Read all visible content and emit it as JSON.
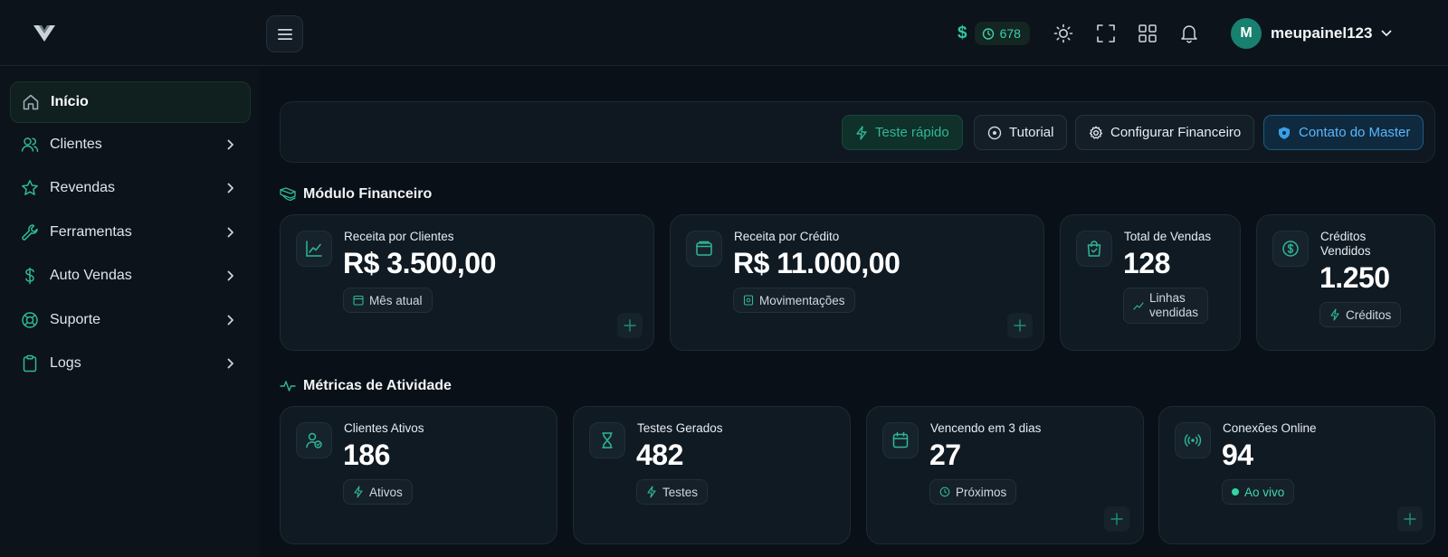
{
  "topbar": {
    "currency_symbol": "$",
    "balance": "678",
    "user_initial": "M",
    "username": "meupainel123"
  },
  "sidebar": {
    "items": [
      {
        "label": "Início",
        "icon": "home-icon",
        "active": true
      },
      {
        "label": "Clientes",
        "icon": "users-icon"
      },
      {
        "label": "Revendas",
        "icon": "star-icon"
      },
      {
        "label": "Ferramentas",
        "icon": "wrench-icon"
      },
      {
        "label": "Auto Vendas",
        "icon": "dollar-icon"
      },
      {
        "label": "Suporte",
        "icon": "lifebuoy-icon"
      },
      {
        "label": "Logs",
        "icon": "clipboard-icon"
      }
    ]
  },
  "actions": {
    "quick_test": "Teste rápido",
    "tutorial": "Tutorial",
    "config_finance": "Configurar Financeiro",
    "contact_master": "Contato do Master"
  },
  "finance": {
    "section_title": "Módulo Financeiro",
    "cards": [
      {
        "title": "Receita por Clientes",
        "value": "R$ 3.500,00",
        "chip": "Mês atual",
        "icon": "chart-line-icon"
      },
      {
        "title": "Receita por Crédito",
        "value": "R$ 11.000,00",
        "chip": "Movimentações",
        "icon": "wallet-icon"
      },
      {
        "title": "Total de Vendas",
        "value": "128",
        "chip_line1": "Linhas",
        "chip_line2": "vendidas",
        "icon": "shopping-bag-icon"
      },
      {
        "title_line1": "Créditos",
        "title_line2": "Vendidos",
        "value": "1.250",
        "chip": "Créditos",
        "icon": "coin-icon"
      }
    ]
  },
  "activity": {
    "section_title": "Métricas de Atividade",
    "cards": [
      {
        "title": "Clientes Ativos",
        "value": "186",
        "chip": "Ativos",
        "icon": "user-check-icon"
      },
      {
        "title": "Testes Gerados",
        "value": "482",
        "chip": "Testes",
        "icon": "hourglass-icon"
      },
      {
        "title": "Vencendo em 3 dias",
        "value": "27",
        "chip": "Próximos",
        "icon": "calendar-icon"
      },
      {
        "title": "Conexões Online",
        "value": "94",
        "chip": "Ao vivo",
        "icon": "broadcast-icon"
      }
    ]
  },
  "colors": {
    "accent": "#2fc7a4",
    "master_blue": "#5bb6ff",
    "background": "#0a1017",
    "card": "#101a22"
  }
}
